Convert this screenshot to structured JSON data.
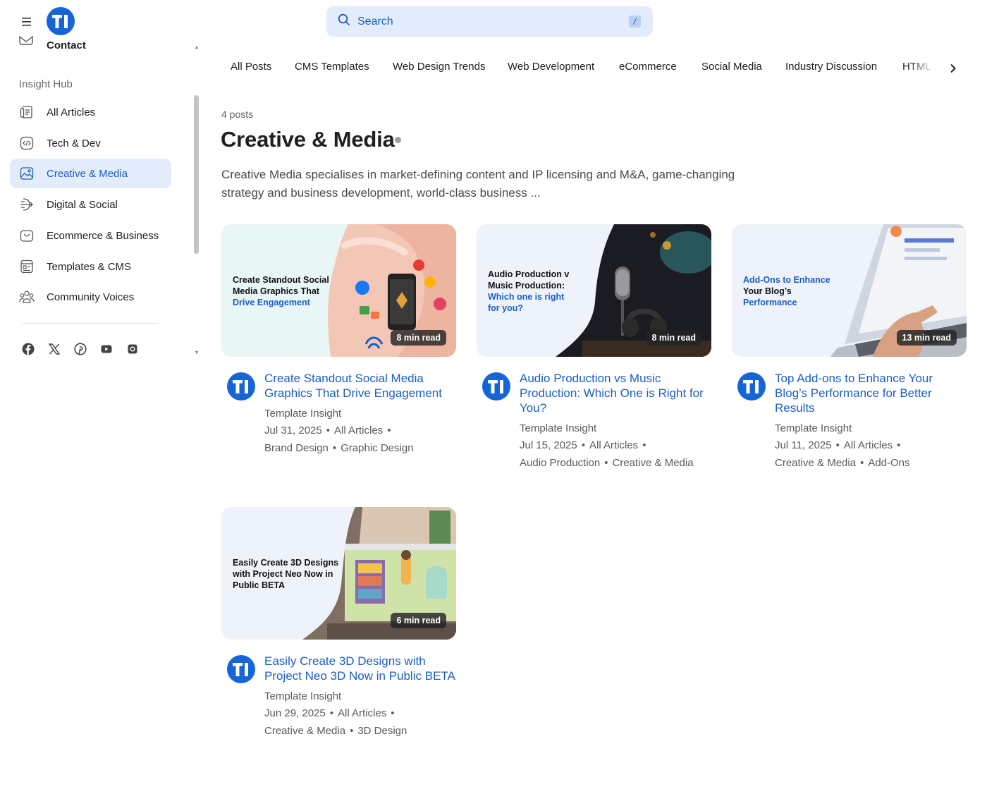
{
  "header": {
    "search_placeholder": "Search",
    "search_shortcut": "/"
  },
  "sidebar": {
    "contact_label": "Contact",
    "section_label": "Insight Hub",
    "items": [
      {
        "label": "All Articles",
        "icon": "articles-icon",
        "active": false
      },
      {
        "label": "Tech & Dev",
        "icon": "code-icon",
        "active": false
      },
      {
        "label": "Creative & Media",
        "icon": "image-icon",
        "active": true
      },
      {
        "label": "Digital & Social",
        "icon": "share-icon",
        "active": false
      },
      {
        "label": "Ecommerce & Business",
        "icon": "bag-icon",
        "active": false
      },
      {
        "label": "Templates & CMS",
        "icon": "template-icon",
        "active": false
      },
      {
        "label": "Community Voices",
        "icon": "people-icon",
        "active": false
      }
    ],
    "social": [
      "facebook-icon",
      "x-icon",
      "pinterest-icon",
      "youtube-icon",
      "instagram-icon"
    ]
  },
  "tabs": [
    "All Posts",
    "CMS Templates",
    "Web Design Trends",
    "Web Development",
    "eCommerce",
    "Social Media",
    "Industry Discussion",
    "HTML Te"
  ],
  "page": {
    "count": "4 posts",
    "title": "Creative & Media",
    "description": "Creative Media specialises in market-defining content and IP licensing and M&A, game-changing strategy and business development, world-class business ..."
  },
  "posts": [
    {
      "thumb_lines": [
        "Create Standout Social",
        "Media Graphics That",
        "Drive Engagement"
      ],
      "read_time": "8 min read",
      "title": "Create Standout Social Media Graphics That Drive Engagement",
      "author": "Template Insight",
      "date": "Jul 31, 2025",
      "category": "All Articles",
      "tags": [
        "Brand Design",
        "Graphic Design"
      ]
    },
    {
      "thumb_lines": [
        "Audio Production v",
        "Music Production:",
        "Which one is right",
        "for you?"
      ],
      "read_time": "8 min read",
      "title": "Audio Production vs Music Production: Which One is Right for You?",
      "author": "Template Insight",
      "date": "Jul 15, 2025",
      "category": "All Articles",
      "tags": [
        "Audio Production",
        "Creative & Media"
      ]
    },
    {
      "thumb_lines": [
        "Add-Ons to Enhance",
        "Your Blog’s",
        "Performance"
      ],
      "read_time": "13 min read",
      "title": "Top Add-ons to Enhance Your Blog’s Performance for Better Results",
      "author": "Template Insight",
      "date": "Jul 11, 2025",
      "category": "All Articles",
      "tags": [
        "Creative & Media",
        "Add-Ons"
      ]
    },
    {
      "thumb_lines": [
        "Easily Create 3D Designs",
        "with Project Neo Now in",
        "Public BETA"
      ],
      "read_time": "6 min read",
      "title": "Easily Create 3D Designs with Project Neo 3D Now in Public BETA",
      "author": "Template Insight",
      "date": "Jun 29, 2025",
      "category": "All Articles",
      "tags": [
        "Creative & Media",
        "3D Design"
      ]
    }
  ],
  "colors": {
    "accent": "#1a5dc8",
    "active_bg": "#e3ecfa",
    "logo": "#1565d8"
  }
}
